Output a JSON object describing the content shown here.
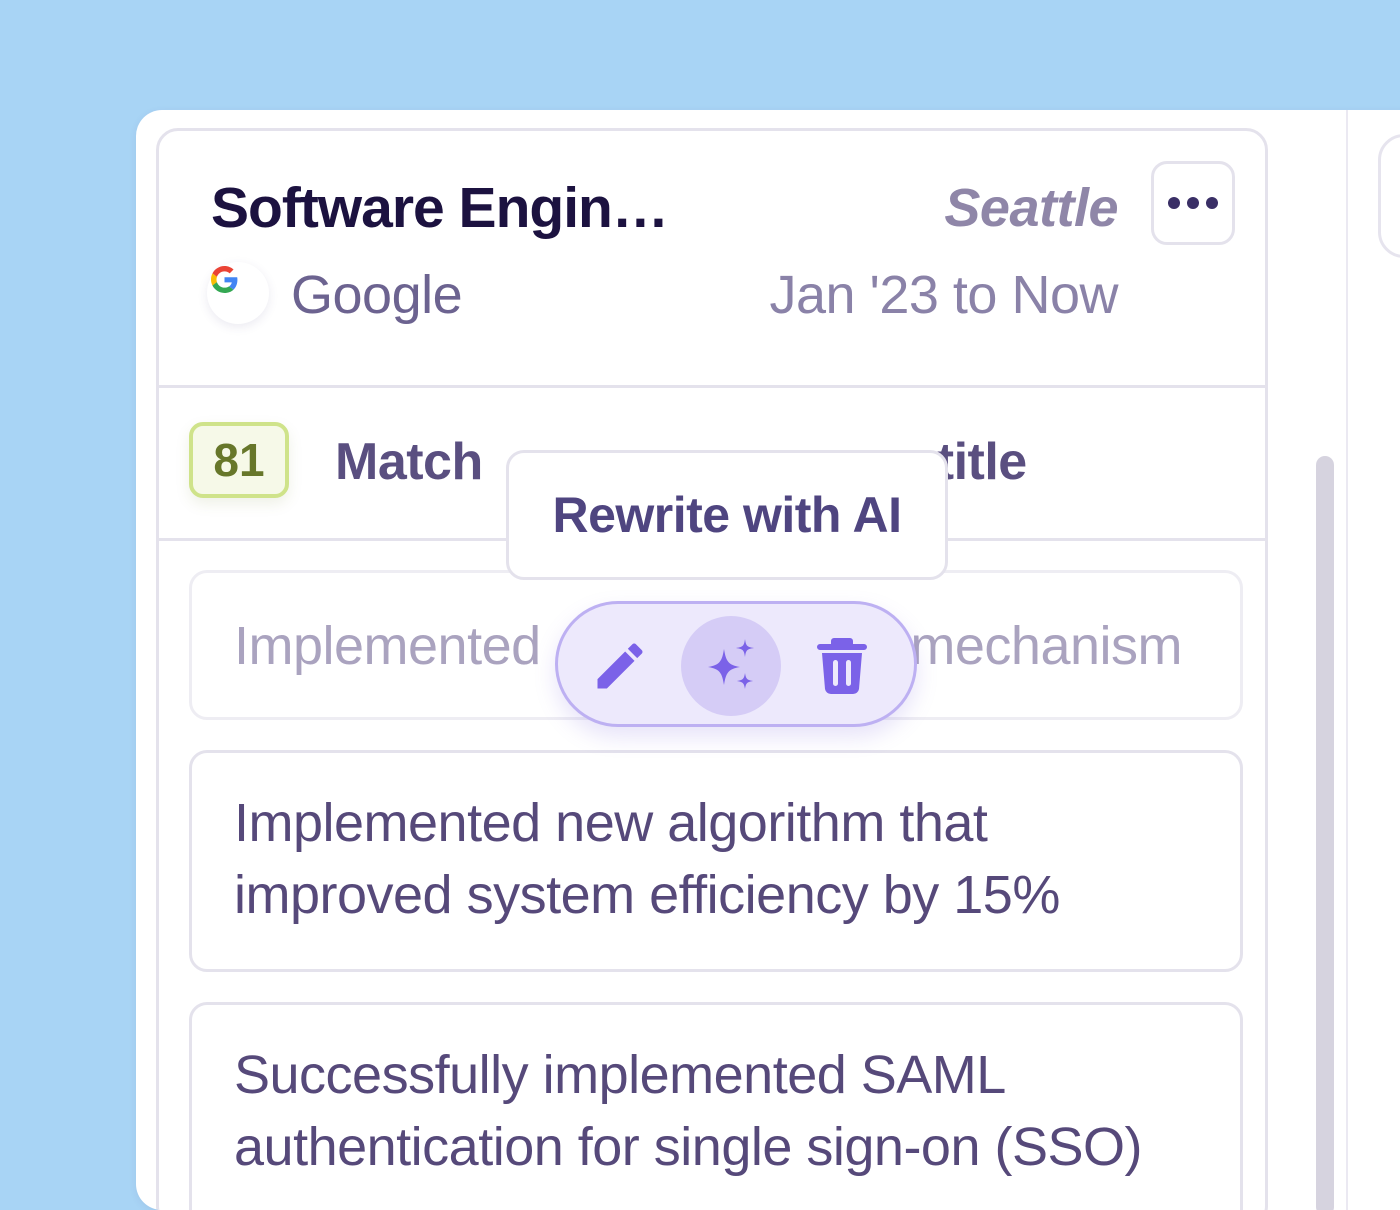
{
  "job": {
    "title": "Software Engin…",
    "location": "Seattle",
    "company": "Google",
    "dates": "Jan '23 to Now"
  },
  "match": {
    "score": "81",
    "label_left": "Match",
    "label_right": "title"
  },
  "tooltip": {
    "text": "Rewrite with AI"
  },
  "bullets": [
    {
      "text_left": "Implemented",
      "text_right": "mechanism"
    },
    {
      "text": "Implemented new algorithm that improved system efficiency by 15%"
    },
    {
      "text": "Successfully implemented SAML authentication for single sign-on (SSO)"
    }
  ],
  "icons": {
    "more": "more-horizontal-icon",
    "edit": "pencil-icon",
    "ai": "sparkles-icon",
    "delete": "trash-icon",
    "company": "google-logo"
  },
  "colors": {
    "background": "#a8d4f5",
    "accent": "#7b62e8",
    "score_badge_border": "#cfe38a",
    "score_badge_text": "#67772a"
  }
}
